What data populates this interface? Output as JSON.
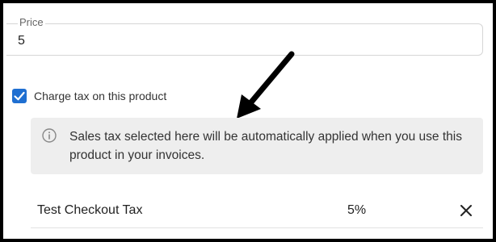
{
  "price": {
    "label": "Price",
    "value": "5"
  },
  "charge_tax": {
    "checked": true,
    "label": "Charge tax on this product"
  },
  "info": {
    "icon": "info-icon",
    "message": "Sales tax selected here will be automatically applied when you use this product in your invoices."
  },
  "tax_row": {
    "name": "Test Checkout Tax",
    "rate": "5%",
    "remove_icon": "close-icon"
  },
  "colors": {
    "checkbox": "#1f6fd1",
    "info_background": "#eeeeee",
    "frame_border": "#000000"
  }
}
